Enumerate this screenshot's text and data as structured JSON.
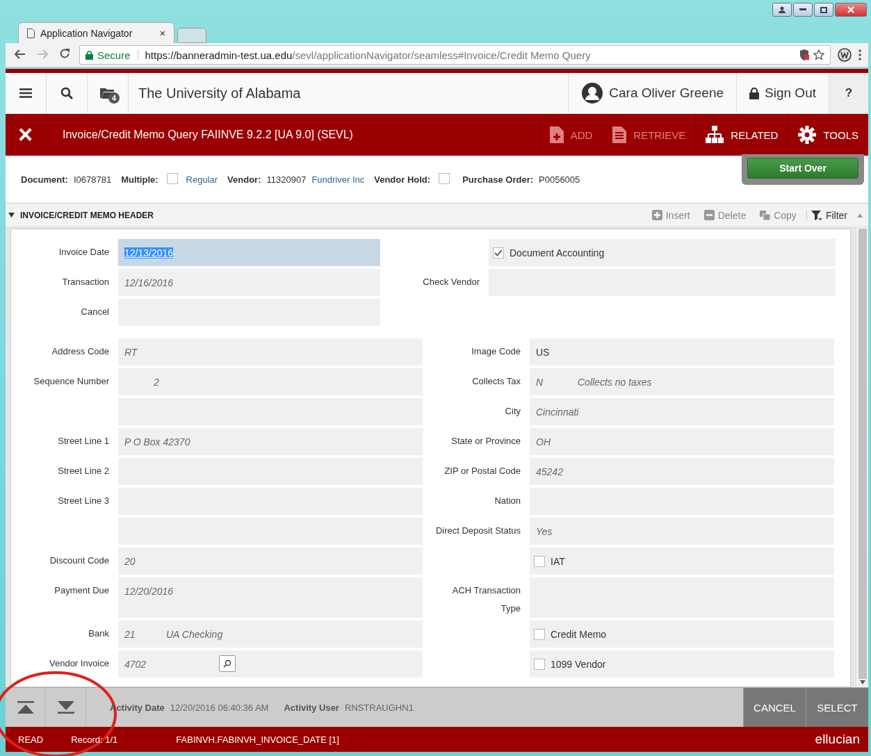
{
  "browser": {
    "tabs": [
      {
        "label": "Application Navigator",
        "close": "×",
        "selected": true
      }
    ],
    "secure_label": "Secure",
    "url_host": "https://banneradmin-test.ua.edu",
    "url_path": "/sevl/applicationNavigator/seamless#Invoice/Credit Memo Query"
  },
  "header": {
    "notifications": "4",
    "institution": "The University of Alabama",
    "user": "Cara Oliver Greene",
    "sign_out": "Sign Out",
    "help": "?"
  },
  "toolbar": {
    "close": "×",
    "title": "Invoice/Credit Memo Query FAIINVE 9.2.2 [UA 9.0] (SEVL)",
    "actions": [
      {
        "kind": "add",
        "label": "ADD",
        "disabled": true
      },
      {
        "kind": "retrieve",
        "label": "RETRIEVE",
        "disabled": true
      },
      {
        "kind": "related",
        "label": "RELATED",
        "disabled": false
      },
      {
        "kind": "tools",
        "label": "TOOLS",
        "disabled": false
      }
    ]
  },
  "key_block": {
    "items": [
      {
        "kind": "value",
        "label": "Document:",
        "value": "I0678781"
      },
      {
        "kind": "checkbox",
        "label": "Multiple:",
        "checked": false
      },
      {
        "kind": "link",
        "value": "Regular"
      },
      {
        "kind": "value",
        "label": "Vendor:",
        "value": "11320907"
      },
      {
        "kind": "link",
        "value": "Fundriver Inc"
      },
      {
        "kind": "checkbox",
        "label": "Vendor Hold:",
        "checked": false
      },
      {
        "kind": "value",
        "label": "Purchase Order:",
        "value": "P0056005"
      }
    ],
    "start_over": "Start Over"
  },
  "section": {
    "title": "INVOICE/CREDIT MEMO HEADER",
    "expanded": true,
    "actions": [
      {
        "kind": "insert",
        "label": "Insert",
        "disabled": true
      },
      {
        "kind": "delete",
        "label": "Delete",
        "disabled": true
      },
      {
        "kind": "copy",
        "label": "Copy",
        "disabled": true
      },
      {
        "kind": "filter",
        "label": "Filter",
        "disabled": false
      }
    ]
  },
  "top_rows": [
    {
      "left": {
        "kind": "field",
        "label": "Invoice Date",
        "value": "12/13/2016",
        "italic": false,
        "selected": true
      },
      "right": {
        "kind": "checkbox",
        "label": "Document Accounting",
        "checked": true
      }
    },
    {
      "left": {
        "kind": "field",
        "label": "Transaction",
        "value": "12/16/2016",
        "italic": true,
        "selected": false
      },
      "right": {
        "kind": "field",
        "label": "Check Vendor",
        "selected": false
      }
    },
    {
      "left": {
        "kind": "field",
        "label": "Cancel",
        "selected": false
      },
      "right": {
        "kind": "none"
      }
    }
  ],
  "rows": [
    {
      "left": {
        "kind": "field",
        "label": "Address Code",
        "value": "RT",
        "italic": true,
        "selected": false
      },
      "right": {
        "kind": "field",
        "label": "Image Code",
        "value": "US",
        "italic": false,
        "selected": false
      }
    },
    {
      "left": {
        "kind": "number",
        "label": "Sequence Number",
        "value": "2",
        "italic": true,
        "selected": false
      },
      "right": {
        "kind": "field",
        "label": "Collects Tax",
        "value": "N",
        "description": "Collects no taxes",
        "italic": true,
        "selected": false
      }
    },
    {
      "left": {
        "kind": "field",
        "selected": false
      },
      "right": {
        "kind": "field",
        "label": "City",
        "value": "Cincinnati",
        "italic": true,
        "selected": false
      }
    },
    {
      "left": {
        "kind": "field",
        "label": "Street Line 1",
        "value": "P O Box 42370",
        "italic": true,
        "selected": false
      },
      "right": {
        "kind": "field",
        "label": "State or Province",
        "value": "OH",
        "italic": true,
        "selected": false
      }
    },
    {
      "left": {
        "kind": "field",
        "label": "Street Line 2",
        "selected": false
      },
      "right": {
        "kind": "field",
        "label": "ZIP or Postal Code",
        "value": "45242",
        "italic": true,
        "selected": false
      }
    },
    {
      "left": {
        "kind": "field",
        "label": "Street Line 3",
        "selected": false
      },
      "right": {
        "kind": "field",
        "label": "Nation",
        "selected": false
      }
    },
    {
      "left": {
        "kind": "field",
        "selected": false
      },
      "right": {
        "kind": "field",
        "label": "Direct Deposit Status",
        "value": "Yes",
        "italic": true,
        "selected": false
      }
    },
    {
      "left": {
        "kind": "field",
        "label": "Discount Code",
        "value": "20",
        "italic": true,
        "selected": false
      },
      "right": {
        "kind": "checkbox",
        "label": "IAT",
        "checked": false
      }
    },
    {
      "left": {
        "kind": "field",
        "label": "Payment Due",
        "value": "12/20/2016",
        "italic": true,
        "selected": false
      },
      "right": {
        "kind": "field",
        "label": "ACH Transaction Type",
        "selected": false
      }
    },
    {
      "left": {
        "kind": "field",
        "label": "Bank",
        "value": "21",
        "description": "UA Checking",
        "italic": true,
        "selected": false
      },
      "right": {
        "kind": "checkbox",
        "label": "Credit Memo",
        "checked": false
      }
    },
    {
      "left": {
        "kind": "lookup",
        "label": "Vendor Invoice",
        "value": "4702",
        "italic": true,
        "selected": false
      },
      "right": {
        "kind": "checkbox",
        "label": "1099 Vendor",
        "checked": false
      }
    }
  ],
  "footer": {
    "activity_date_label": "Activity Date",
    "activity_date": "12/20/2016 06:40:36 AM",
    "activity_user_label": "Activity User",
    "activity_user": "RNSTRAUGHN1",
    "buttons": [
      "CANCEL",
      "SELECT"
    ]
  },
  "status_bar": {
    "mode": "READ",
    "record": "Record: 1/1",
    "field": "FABINVH.FABINVH_INVOICE_DATE [1]",
    "brand": "ellucian"
  }
}
